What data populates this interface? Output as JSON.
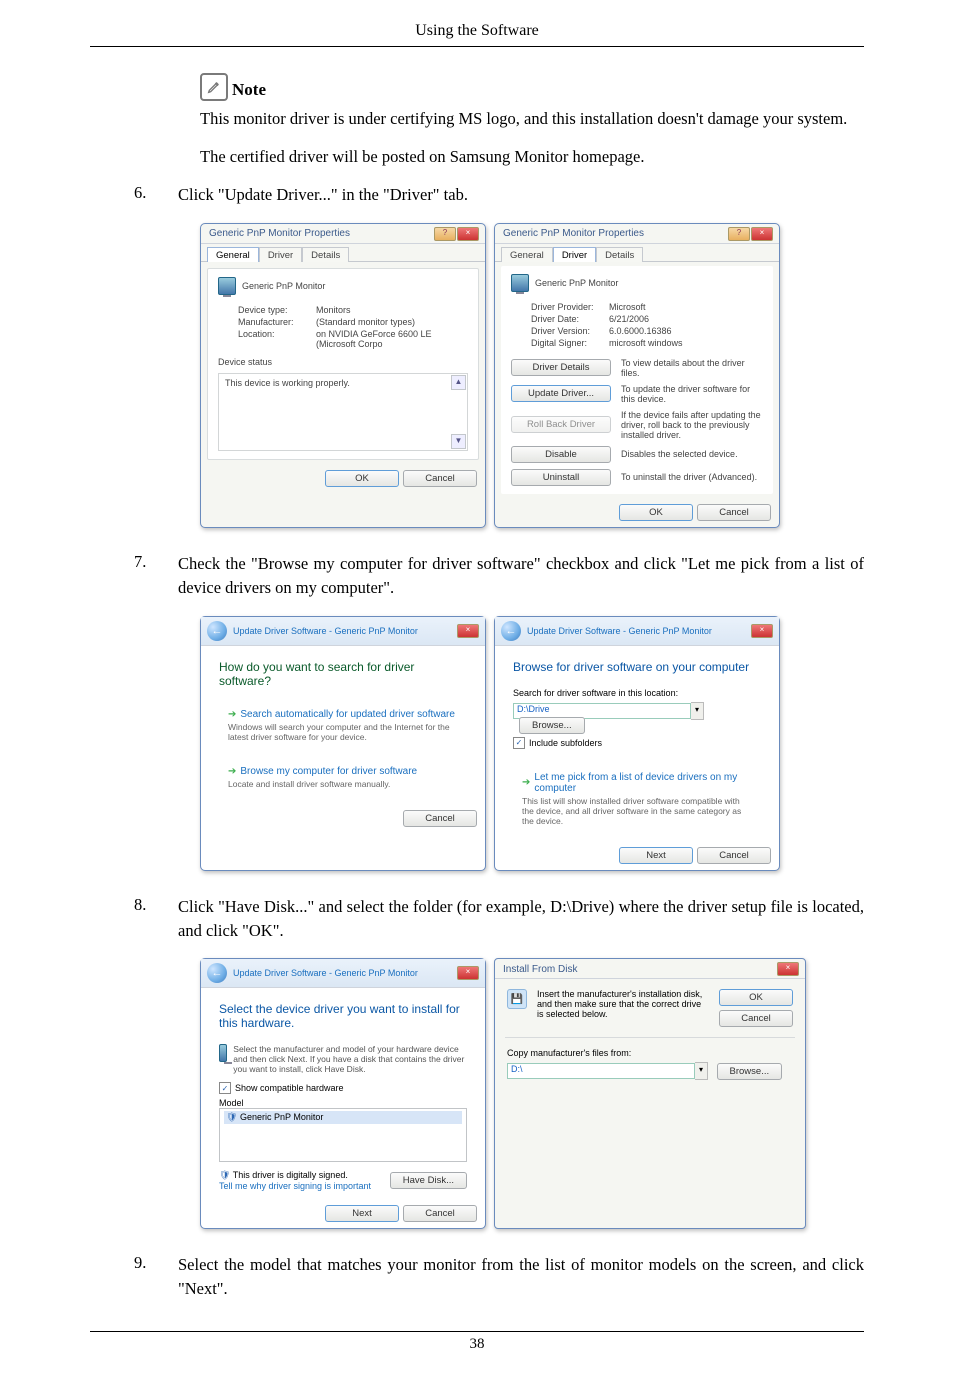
{
  "header": {
    "title": "Using the Software"
  },
  "note": {
    "label": "Note",
    "line1": "This monitor driver is under certifying MS logo, and this installation doesn't damage your system.",
    "line2": "The certified driver will be posted on Samsung Monitor homepage."
  },
  "steps": {
    "s6": {
      "num": "6.",
      "text": "Click \"Update Driver...\" in the \"Driver\" tab."
    },
    "s7": {
      "num": "7.",
      "text": "Check the \"Browse my computer for driver software\" checkbox and click \"Let me pick from a list of device drivers on my computer\"."
    },
    "s8": {
      "num": "8.",
      "text": "Click \"Have Disk...\" and select the folder (for example, D:\\Drive) where the driver setup file is located, and click \"OK\"."
    },
    "s9": {
      "num": "9.",
      "text": "Select the model that matches your monitor from the list of monitor models on the screen, and click \"Next\"."
    }
  },
  "fig6": {
    "left": {
      "title": "Generic PnP Monitor Properties",
      "tabs": {
        "general": "General",
        "driver": "Driver",
        "details": "Details"
      },
      "deviceName": "Generic PnP Monitor",
      "kvs": {
        "type_k": "Device type:",
        "type_v": "Monitors",
        "mfr_k": "Manufacturer:",
        "mfr_v": "(Standard monitor types)",
        "loc_k": "Location:",
        "loc_v": "on NVIDIA GeForce 6600 LE (Microsoft Corpo"
      },
      "status_label": "Device status",
      "status_text": "This device is working properly.",
      "ok": "OK",
      "cancel": "Cancel"
    },
    "right": {
      "title": "Generic PnP Monitor Properties",
      "tabs": {
        "general": "General",
        "driver": "Driver",
        "details": "Details"
      },
      "deviceName": "Generic PnP Monitor",
      "kvs": {
        "prov_k": "Driver Provider:",
        "prov_v": "Microsoft",
        "date_k": "Driver Date:",
        "date_v": "6/21/2006",
        "ver_k": "Driver Version:",
        "ver_v": "6.0.6000.16386",
        "sig_k": "Digital Signer:",
        "sig_v": "microsoft windows"
      },
      "actions": {
        "details": "Driver Details",
        "details_desc": "To view details about the driver files.",
        "update": "Update Driver...",
        "update_desc": "To update the driver software for this device.",
        "rollback": "Roll Back Driver",
        "rollback_desc": "If the device fails after updating the driver, roll back to the previously installed driver.",
        "disable": "Disable",
        "disable_desc": "Disables the selected device.",
        "uninstall": "Uninstall",
        "uninstall_desc": "To uninstall the driver (Advanced)."
      },
      "ok": "OK",
      "cancel": "Cancel"
    }
  },
  "fig7": {
    "left": {
      "crumb": "Update Driver Software - Generic PnP Monitor",
      "title": "How do you want to search for driver software?",
      "opt1": {
        "title": "Search automatically for updated driver software",
        "desc": "Windows will search your computer and the Internet for the latest driver software for your device."
      },
      "opt2": {
        "title": "Browse my computer for driver software",
        "desc": "Locate and install driver software manually."
      },
      "cancel": "Cancel"
    },
    "right": {
      "crumb": "Update Driver Software - Generic PnP Monitor",
      "title": "Browse for driver software on your computer",
      "search_label": "Search for driver software in this location:",
      "path": "D:\\Drive",
      "browse": "Browse...",
      "include": "Include subfolders",
      "opt": {
        "title": "Let me pick from a list of device drivers on my computer",
        "desc": "This list will show installed driver software compatible with the device, and all driver software in the same category as the device."
      },
      "next": "Next",
      "cancel": "Cancel"
    }
  },
  "fig8": {
    "left": {
      "crumb": "Update Driver Software - Generic PnP Monitor",
      "title": "Select the device driver you want to install for this hardware.",
      "instr": "Select the manufacturer and model of your hardware device and then click Next. If you have a disk that contains the driver you want to install, click Have Disk.",
      "show_compat": "Show compatible hardware",
      "model_label": "Model",
      "model_item": "Generic PnP Monitor",
      "signed": "This driver is digitally signed.",
      "tell": "Tell me why driver signing is important",
      "have_disk": "Have Disk...",
      "next": "Next",
      "cancel": "Cancel"
    },
    "right": {
      "title": "Install From Disk",
      "msg": "Insert the manufacturer's installation disk, and then make sure that the correct drive is selected below.",
      "ok": "OK",
      "cancel": "Cancel",
      "copy_label": "Copy manufacturer's files from:",
      "path": "D:\\",
      "browse": "Browse..."
    }
  },
  "footer": {
    "page": "38"
  }
}
